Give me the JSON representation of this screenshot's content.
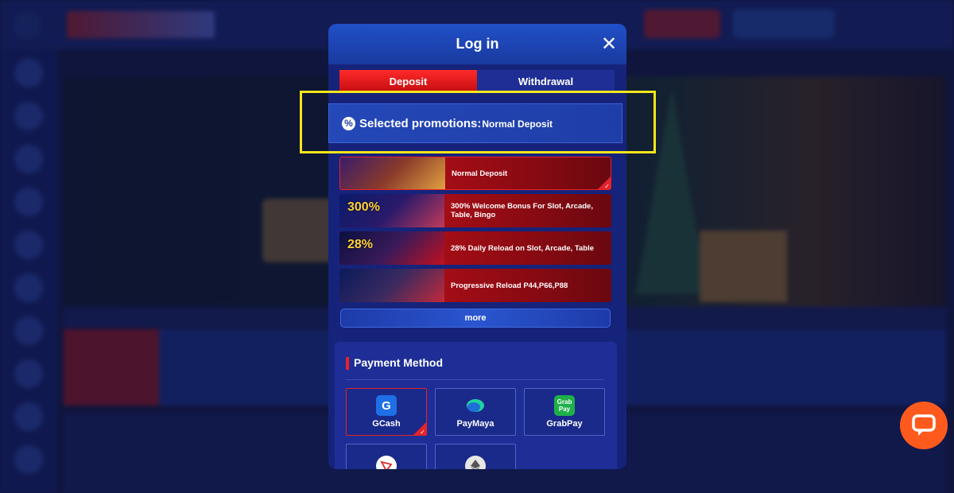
{
  "modal": {
    "title": "Log in",
    "close_glyph": "✕",
    "tabs": [
      {
        "label": "Deposit",
        "active": true
      },
      {
        "label": "Withdrawal",
        "active": false
      }
    ]
  },
  "promotions": {
    "header_label": "Selected promotions:",
    "selected_value": "Normal Deposit",
    "items": [
      {
        "title": "Normal Deposit",
        "selected": true,
        "thumb_text": ""
      },
      {
        "title": "300% Welcome Bonus For Slot, Arcade, Table, Bingo",
        "selected": false,
        "thumb_text": "300%"
      },
      {
        "title": "28% Daily Reload on Slot, Arcade, Table",
        "selected": false,
        "thumb_text": "28%"
      },
      {
        "title": "Progressive Reload P44,P66,P88",
        "selected": false,
        "thumb_text": ""
      }
    ],
    "more_label": "more"
  },
  "payment": {
    "title": "Payment Method",
    "methods": [
      {
        "label": "GCash",
        "icon": "gcash-icon",
        "selected": true
      },
      {
        "label": "PayMaya",
        "icon": "paymaya-icon",
        "selected": false
      },
      {
        "label": "GrabPay",
        "icon": "grabpay-icon",
        "selected": false
      },
      {
        "label": "",
        "icon": "tron-icon",
        "selected": false
      },
      {
        "label": "",
        "icon": "ethereum-icon",
        "selected": false
      }
    ]
  },
  "colors": {
    "modal_bg": "#16237a",
    "accent_red": "#e6222a",
    "highlight": "#f5e61a",
    "chat_button": "#ff5a1e"
  }
}
